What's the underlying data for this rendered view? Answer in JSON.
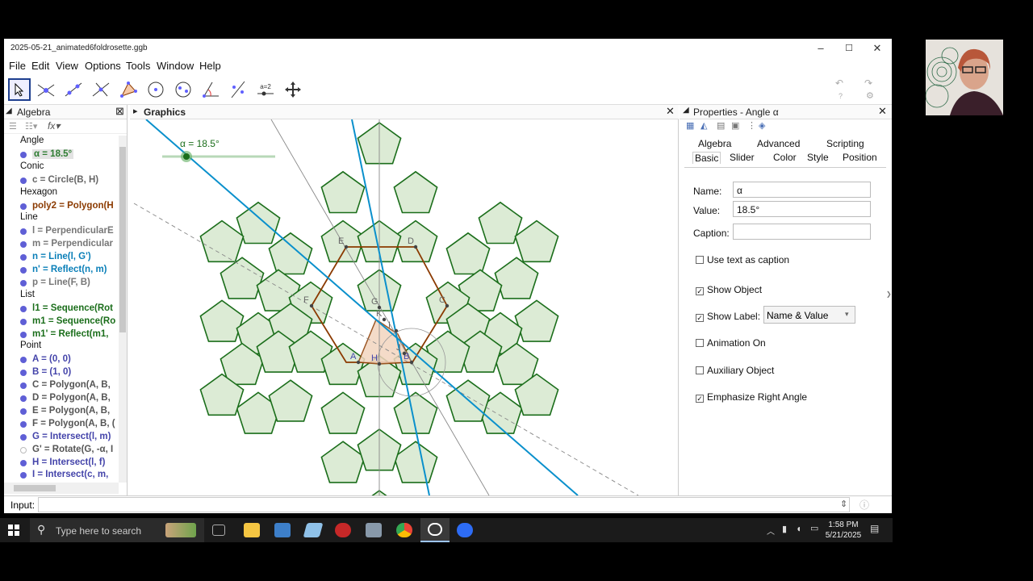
{
  "window": {
    "title": "2025-05-21_animated6foldrosette.ggb",
    "controls": [
      "–",
      "☐",
      "✕"
    ]
  },
  "menu": [
    "File",
    "Edit",
    "View",
    "Options",
    "Tools",
    "Window",
    "Help"
  ],
  "toolbar": {
    "tools": [
      "move-tool",
      "point-tool",
      "line-tool",
      "perpendicular-tool",
      "polygon-tool",
      "circle-tool",
      "conic-tool",
      "angle-tool",
      "reflect-tool",
      "slider-tool",
      "move-view-tool"
    ],
    "slider_tool_label": "a=2"
  },
  "algebra": {
    "title": "Algebra",
    "rows": [
      {
        "type": "cat",
        "text": "Angle"
      },
      {
        "type": "item",
        "text": "α = 18.5°",
        "color": "#2e7d32",
        "selected": true
      },
      {
        "type": "cat",
        "text": "Conic"
      },
      {
        "type": "item",
        "text": "c = Circle(B, H)",
        "color": "#666666"
      },
      {
        "type": "cat",
        "text": "Hexagon"
      },
      {
        "type": "item",
        "text": "poly2 = Polygon(H",
        "color": "#8b3a00"
      },
      {
        "type": "cat",
        "text": "Line"
      },
      {
        "type": "item",
        "text": "l = PerpendicularE",
        "color": "#777777"
      },
      {
        "type": "item",
        "text": "m = Perpendicular",
        "color": "#777777"
      },
      {
        "type": "item",
        "text": "n = Line(l, G')",
        "color": "#0a7fb8"
      },
      {
        "type": "item",
        "text": "n' = Reflect(n, m)",
        "color": "#0a7fb8"
      },
      {
        "type": "item",
        "text": "p = Line(F, B)",
        "color": "#777777"
      },
      {
        "type": "cat",
        "text": "List"
      },
      {
        "type": "item",
        "text": "l1 = Sequence(Rot",
        "color": "#1b6e1b"
      },
      {
        "type": "item",
        "text": "m1 = Sequence(Ro",
        "color": "#1b6e1b"
      },
      {
        "type": "item",
        "text": "m1' = Reflect(m1,",
        "color": "#1b6e1b"
      },
      {
        "type": "cat",
        "text": "Point"
      },
      {
        "type": "item",
        "text": "A = (0, 0)",
        "color": "#4444aa"
      },
      {
        "type": "item",
        "text": "B = (1, 0)",
        "color": "#4444aa"
      },
      {
        "type": "item",
        "text": "C = Polygon(A, B,",
        "color": "#555555"
      },
      {
        "type": "item",
        "text": "D = Polygon(A, B,",
        "color": "#555555"
      },
      {
        "type": "item",
        "text": "E = Polygon(A, B,",
        "color": "#555555"
      },
      {
        "type": "item",
        "text": "F = Polygon(A, B, (",
        "color": "#555555"
      },
      {
        "type": "item",
        "text": "G = Intersect(l, m)",
        "color": "#4444aa"
      },
      {
        "type": "item",
        "text": "G' = Rotate(G, -α, I",
        "color": "#555555"
      },
      {
        "type": "item",
        "text": "H = Intersect(l, f)",
        "color": "#4444aa"
      },
      {
        "type": "item",
        "text": "I = Intersect(c, m,",
        "color": "#4444aa"
      }
    ]
  },
  "graphics": {
    "title": "Graphics",
    "slider_label": "α = 18.5°",
    "points": [
      "A",
      "B",
      "C",
      "D",
      "E",
      "F",
      "G",
      "H",
      "I",
      "J",
      "K"
    ]
  },
  "properties": {
    "title": "Properties - Angle α",
    "tabs_row1": [
      "Algebra",
      "Advanced",
      "Scripting"
    ],
    "tabs_row2": [
      "Basic",
      "Slider",
      "Color",
      "Style",
      "Position"
    ],
    "active_tab": "Basic",
    "name_label": "Name:",
    "name_value": "α",
    "value_label": "Value:",
    "value_value": "18.5°",
    "caption_label": "Caption:",
    "caption_value": "",
    "use_text_as_caption": "Use text as caption",
    "show_object": "Show Object",
    "show_label": "Show Label:",
    "label_mode": "Name & Value",
    "animation_on": "Animation On",
    "auxiliary_object": "Auxiliary Object",
    "emphasize_right_angle": "Emphasize Right Angle"
  },
  "input": {
    "label": "Input:"
  },
  "taskbar": {
    "search_placeholder": "Type here to search",
    "time": "1:58 PM",
    "date": "5/21/2025"
  },
  "colors": {
    "pentagon_fill": "#dcebd5",
    "pentagon_stroke": "#1b6e1b",
    "hexagon_stroke": "#8b3a00",
    "line_blue": "#0a90cc",
    "selection_blue": "#1e3f8f"
  }
}
